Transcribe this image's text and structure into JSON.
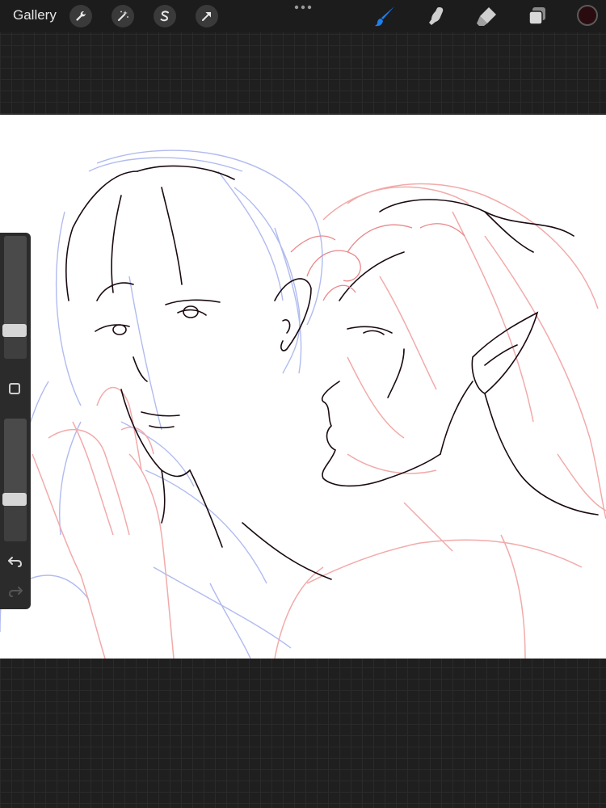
{
  "toolbar": {
    "gallery_label": "Gallery",
    "left_tools": [
      {
        "name": "actions",
        "icon": "wrench-icon"
      },
      {
        "name": "adjustments",
        "icon": "magic-wand-icon"
      },
      {
        "name": "selection",
        "icon": "selection-s-icon"
      },
      {
        "name": "transform",
        "icon": "arrow-cursor-icon"
      }
    ],
    "right_tools": [
      {
        "name": "brush",
        "icon": "brush-icon",
        "active": true
      },
      {
        "name": "smudge",
        "icon": "smudge-finger-icon",
        "active": false
      },
      {
        "name": "eraser",
        "icon": "eraser-icon",
        "active": false
      },
      {
        "name": "layers",
        "icon": "layers-icon",
        "active": false
      }
    ],
    "current_color": "#2a0c10",
    "accent_color": "#1e7ef0"
  },
  "sidebar": {
    "brush_size_level": 0.2,
    "opacity_level": 0.32,
    "undo_icon": "undo-icon",
    "redo_icon": "redo-icon",
    "modify_icon": "square-icon"
  },
  "canvas": {
    "content": "line-art-sketch",
    "line_colors": [
      "#1a0a12",
      "#a9b4ee",
      "#f2a6a6"
    ]
  }
}
